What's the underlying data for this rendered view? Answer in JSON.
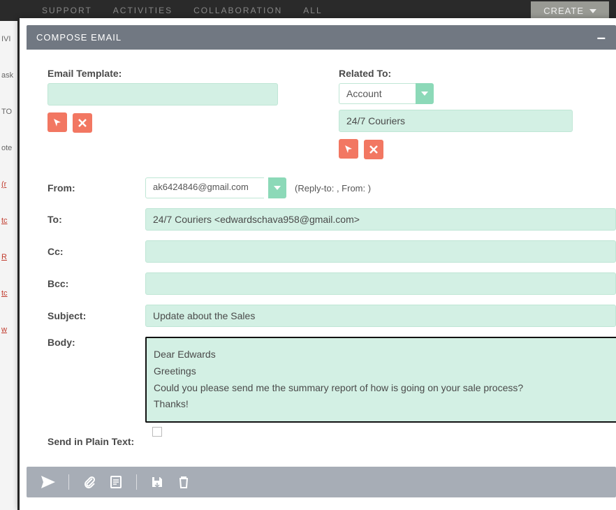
{
  "bg": {
    "nav": [
      "SUPPORT",
      "ACTIVITIES",
      "COLLABORATION",
      "ALL"
    ],
    "create": "CREATE",
    "side": [
      "IVI",
      "ask",
      "TO",
      "ote"
    ]
  },
  "modal": {
    "title": "COMPOSE EMAIL"
  },
  "form": {
    "emailTemplateLabel": "Email Template:",
    "relatedToLabel": "Related To:",
    "relatedType": "Account",
    "relatedValue": "24/7 Couriers",
    "fromLabel": "From:",
    "fromValue": "ak6424846@gmail.com",
    "replyHint": "(Reply-to: , From: )",
    "toLabel": "To:",
    "toValue": "24/7 Couriers <edwardschava958@gmail.com>",
    "ccLabel": "Cc:",
    "ccValue": "",
    "bccLabel": "Bcc:",
    "bccValue": "",
    "subjectLabel": "Subject:",
    "subjectValue": "Update about the Sales",
    "bodyLabel": "Body:",
    "bodyValue": "Dear  Edwards\nGreetings\nCould you please send me the summary report of how is going on your sale process?\nThanks!",
    "plainTextLabel": "Send in Plain Text:"
  },
  "icons": {
    "cursor": "cursor",
    "close": "close",
    "caret": "caret",
    "send": "send",
    "attach": "attach",
    "template": "template",
    "saveDraft": "save-draft",
    "trash": "trash",
    "minimize": "minimize"
  }
}
